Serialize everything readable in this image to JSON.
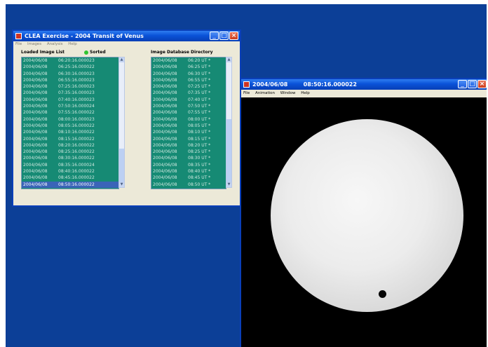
{
  "clea_window": {
    "title": "CLEA Exercise - 2004 Transit of Venus",
    "menu": [
      "File",
      "Images",
      "Analysis",
      "Help"
    ],
    "loaded_header": "Loaded Image List",
    "sorted_label": "Sorted",
    "db_header": "Image Database Directory",
    "loaded_list": [
      {
        "date": "2004/06/08",
        "time": "06:20:16.000023"
      },
      {
        "date": "2004/06/08",
        "time": "06:25:16.000022"
      },
      {
        "date": "2004/06/08",
        "time": "06:30:16.000023"
      },
      {
        "date": "2004/06/08",
        "time": "06:55:16.000023"
      },
      {
        "date": "2004/06/08",
        "time": "07:25:16.000023"
      },
      {
        "date": "2004/06/08",
        "time": "07:35:16.000023"
      },
      {
        "date": "2004/06/08",
        "time": "07:40:16.000023"
      },
      {
        "date": "2004/06/08",
        "time": "07:50:16.000024"
      },
      {
        "date": "2004/06/08",
        "time": "07:55:16.000022"
      },
      {
        "date": "2004/06/08",
        "time": "08:00:16.000023"
      },
      {
        "date": "2004/06/08",
        "time": "08:05:16.000022"
      },
      {
        "date": "2004/06/08",
        "time": "08:10:16.000022"
      },
      {
        "date": "2004/06/08",
        "time": "08:15:16.000022"
      },
      {
        "date": "2004/06/08",
        "time": "08:20:16.000022"
      },
      {
        "date": "2004/06/08",
        "time": "08:25:16.000022"
      },
      {
        "date": "2004/06/08",
        "time": "08:30:16.000022"
      },
      {
        "date": "2004/06/08",
        "time": "08:35:16.000024"
      },
      {
        "date": "2004/06/08",
        "time": "08:40:16.000022"
      },
      {
        "date": "2004/06/08",
        "time": "08:45:16.000022"
      },
      {
        "date": "2004/06/08",
        "time": "08:50:16.000022",
        "selected": true
      }
    ],
    "db_list": [
      {
        "date": "2004/06/08",
        "time": "06:20 UT *"
      },
      {
        "date": "2004/06/08",
        "time": "06:25 UT *"
      },
      {
        "date": "2004/06/08",
        "time": "06:30 UT *"
      },
      {
        "date": "2004/06/08",
        "time": "06:55 UT *"
      },
      {
        "date": "2004/06/08",
        "time": "07:25 UT *"
      },
      {
        "date": "2004/06/08",
        "time": "07:35 UT *"
      },
      {
        "date": "2004/06/08",
        "time": "07:40 UT *"
      },
      {
        "date": "2004/06/08",
        "time": "07:50 UT *"
      },
      {
        "date": "2004/06/08",
        "time": "07:55 UT *"
      },
      {
        "date": "2004/06/08",
        "time": "08:00 UT *"
      },
      {
        "date": "2004/06/08",
        "time": "08:05 UT *"
      },
      {
        "date": "2004/06/08",
        "time": "08:10 UT *"
      },
      {
        "date": "2004/06/08",
        "time": "08:15 UT *"
      },
      {
        "date": "2004/06/08",
        "time": "08:20 UT *"
      },
      {
        "date": "2004/06/08",
        "time": "08:25 UT *"
      },
      {
        "date": "2004/06/08",
        "time": "08:30 UT *"
      },
      {
        "date": "2004/06/08",
        "time": "08:35 UT *"
      },
      {
        "date": "2004/06/08",
        "time": "08:40 UT *"
      },
      {
        "date": "2004/06/08",
        "time": "08:45 UT *"
      },
      {
        "date": "2004/06/08",
        "time": "08:50 UT *"
      }
    ]
  },
  "animation_window": {
    "title": "2004/06/08        08:50:16.000022",
    "menu": [
      "File",
      "Animation",
      "Window",
      "Help"
    ]
  },
  "colors": {
    "desktop": "#0c3f97",
    "list_bg": "#168a74",
    "selection": "#3a64b8",
    "sorted_indicator": "#31c531"
  },
  "icons": {
    "title_close": "×",
    "title_minimize": "_",
    "title_maximize": "□",
    "scroll_up": "▲",
    "scroll_down": "▼"
  }
}
